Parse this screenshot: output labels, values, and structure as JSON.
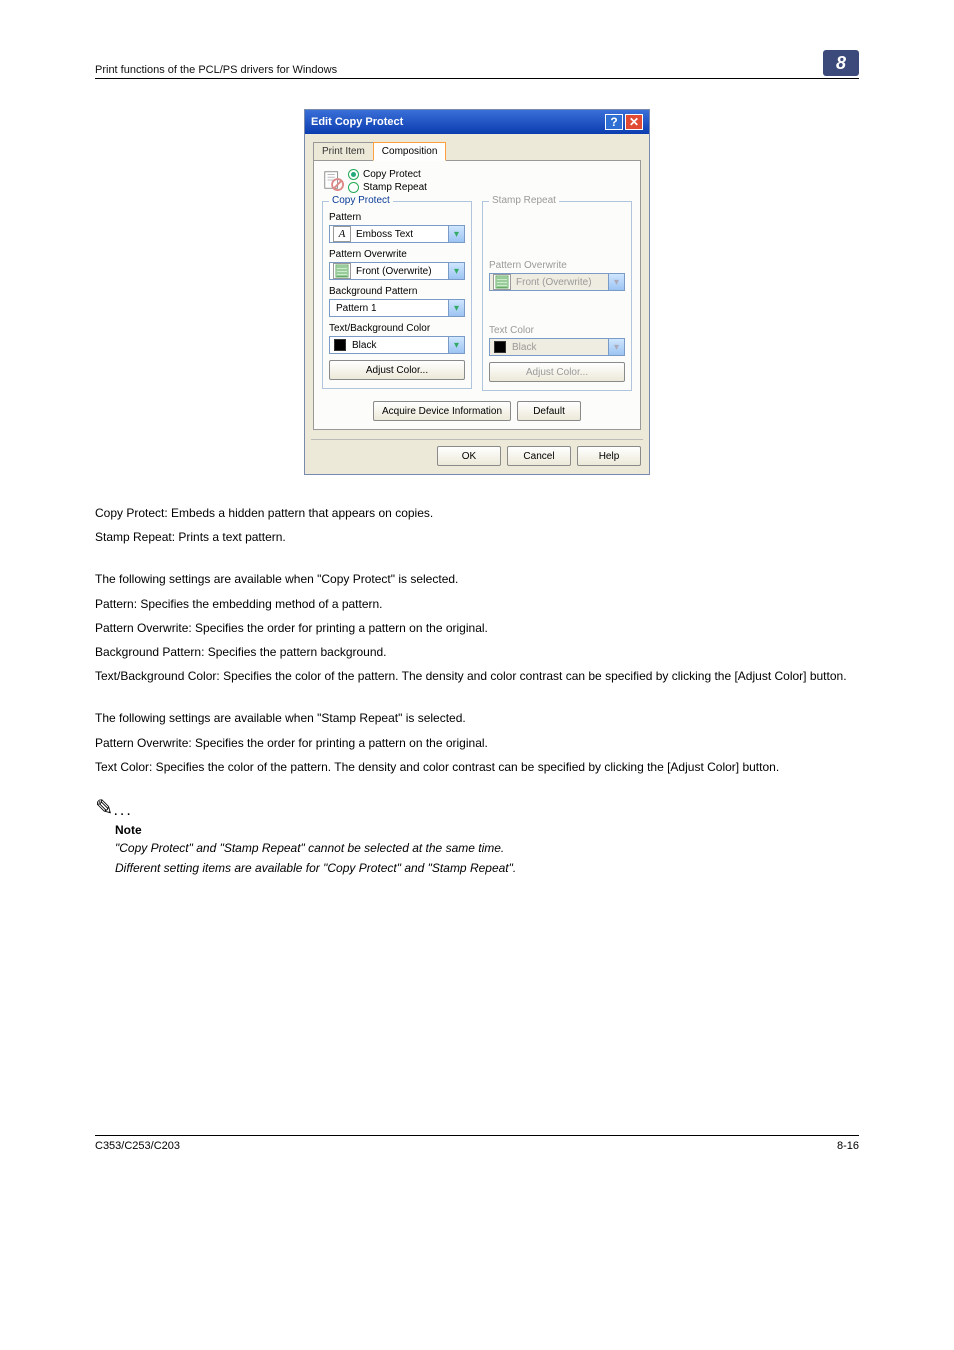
{
  "header": {
    "section_title": "Print functions of the PCL/PS drivers for Windows",
    "chapter": "8"
  },
  "dialog": {
    "title": "Edit Copy Protect",
    "tabs": {
      "print_item": "Print Item",
      "composition": "Composition"
    },
    "mode": {
      "copy_protect": "Copy Protect",
      "stamp_repeat": "Stamp Repeat"
    },
    "copy_protect": {
      "legend": "Copy Protect",
      "pattern_label": "Pattern",
      "pattern_value": "Emboss Text",
      "pattern_overwrite_label": "Pattern Overwrite",
      "pattern_overwrite_value": "Front (Overwrite)",
      "background_pattern_label": "Background Pattern",
      "background_pattern_value": "Pattern 1",
      "text_bg_color_label": "Text/Background Color",
      "text_bg_color_value": "Black",
      "adjust_color": "Adjust Color..."
    },
    "stamp_repeat": {
      "legend": "Stamp Repeat",
      "pattern_overwrite_label": "Pattern Overwrite",
      "pattern_overwrite_value": "Front (Overwrite)",
      "text_color_label": "Text Color",
      "text_color_value": "Black",
      "adjust_color": "Adjust Color..."
    },
    "acquire": "Acquire Device Information",
    "default": "Default",
    "ok": "OK",
    "cancel": "Cancel",
    "help": "Help"
  },
  "body": {
    "p1": "Copy Protect: Embeds a hidden pattern that appears on copies.",
    "p2": "Stamp Repeat: Prints a text pattern.",
    "p3": "The following settings are available when \"Copy Protect\" is selected.",
    "p4": "Pattern: Specifies the embedding method of a pattern.",
    "p5": "Pattern Overwrite: Specifies the order for printing a pattern on the original.",
    "p6": "Background Pattern: Specifies the pattern background.",
    "p7": "Text/Background Color: Specifies the color of the pattern. The density and color contrast can be specified by clicking the [Adjust Color] button.",
    "p8": "The following settings are available when \"Stamp Repeat\" is selected.",
    "p9": "Pattern Overwrite: Specifies the order for printing a pattern on the original.",
    "p10": "Text Color: Specifies the color of the pattern. The density and color contrast can be specified by clicking the [Adjust Color] button.",
    "note_head": "Note",
    "note1": "\"Copy Protect\" and \"Stamp Repeat\" cannot be selected at the same time.",
    "note2": "Different setting items are available for \"Copy Protect\" and \"Stamp Repeat\"."
  },
  "footer": {
    "model": "C353/C253/C203",
    "page": "8-16"
  }
}
